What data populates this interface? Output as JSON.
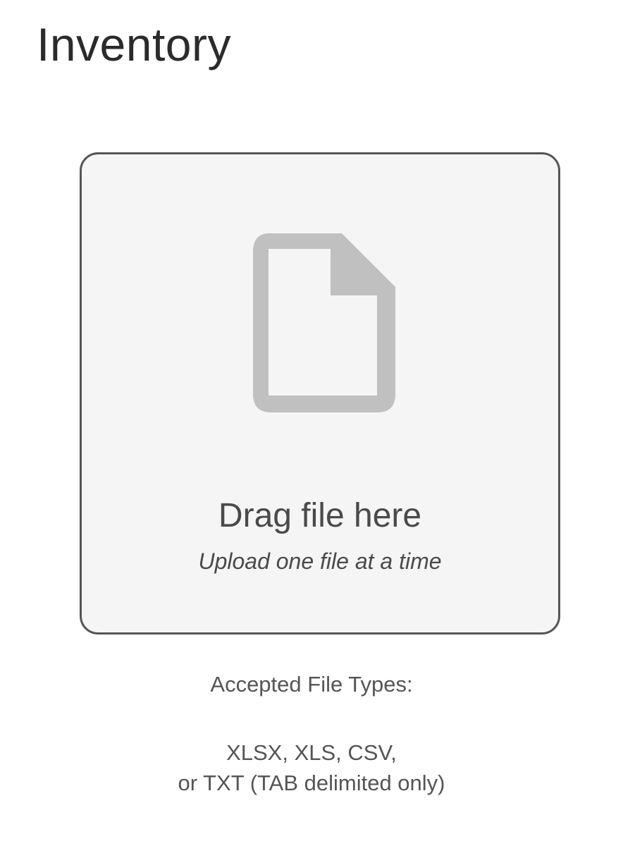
{
  "page": {
    "title": "Inventory"
  },
  "upload": {
    "icon": "file-icon",
    "title": "Drag file here",
    "subtitle": "Upload one file at a time"
  },
  "accepted": {
    "heading": "Accepted File Types:",
    "line1": "XLSX, XLS, CSV,",
    "line2": "or TXT (TAB delimited only)"
  },
  "colors": {
    "border": "#555555",
    "dropzone_background": "#f5f5f5",
    "icon": "#c0c0c0",
    "text": "#4a4a4a"
  }
}
